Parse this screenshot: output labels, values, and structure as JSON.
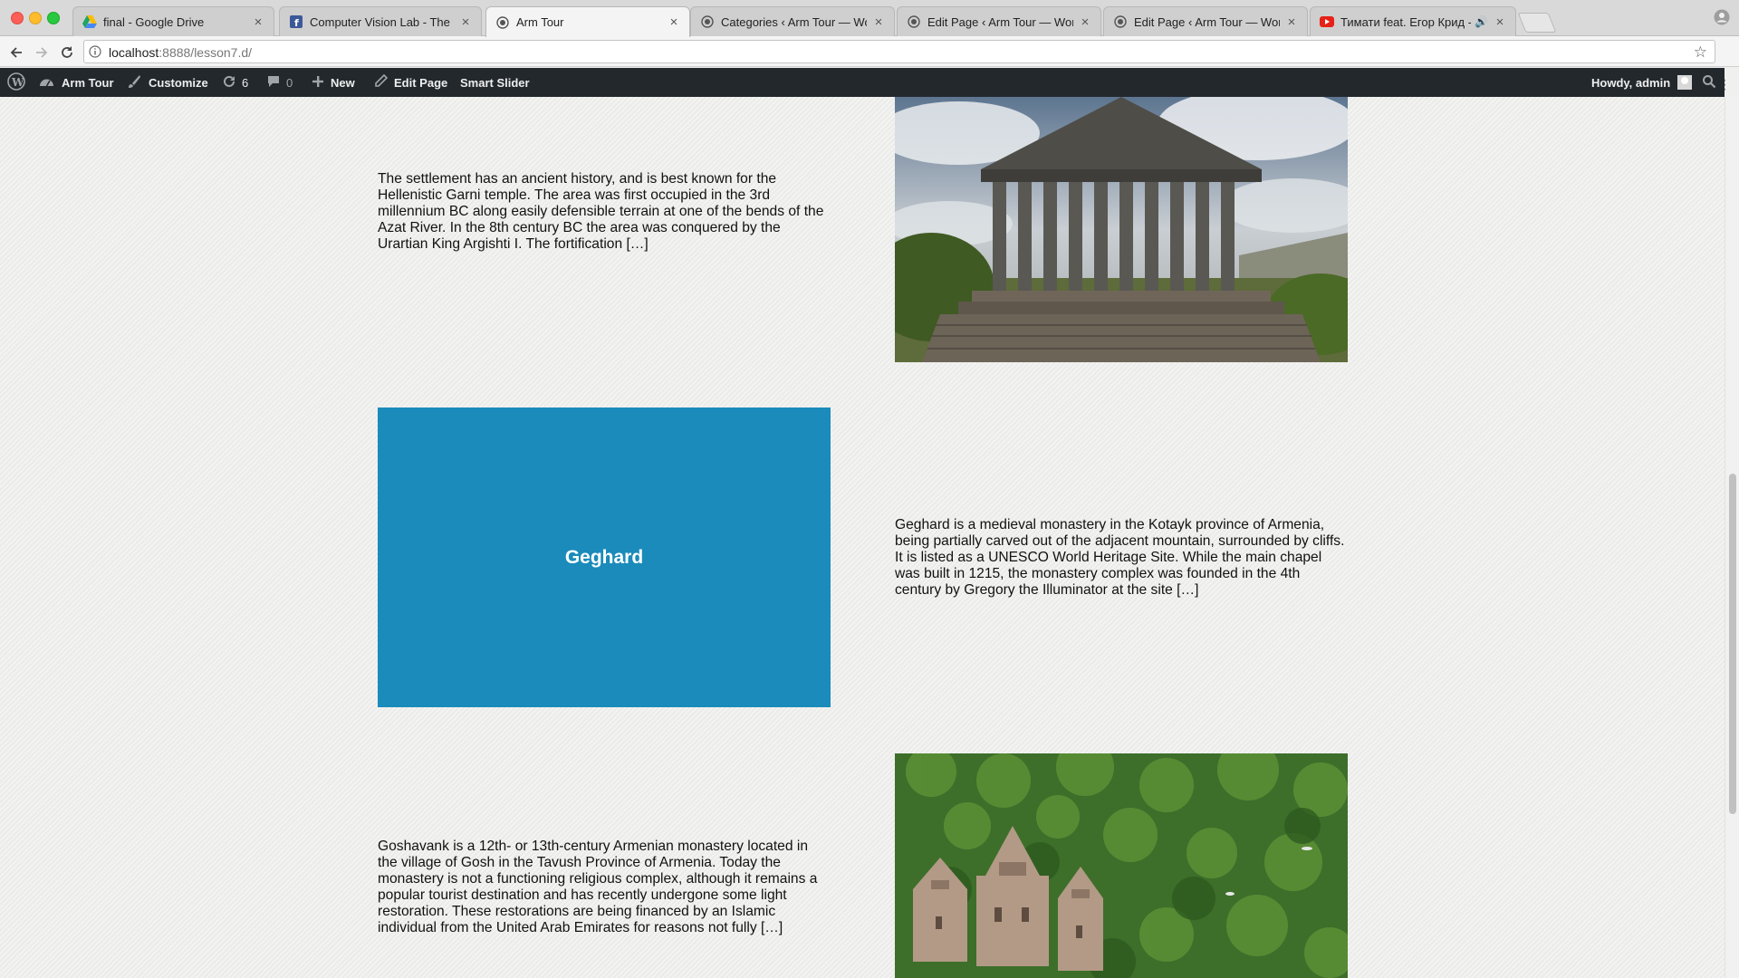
{
  "browser": {
    "tabs": [
      {
        "title": "final - Google Drive",
        "icon": "google-drive-icon",
        "active": false
      },
      {
        "title": "Computer Vision Lab - The Un",
        "icon": "facebook-icon",
        "active": false
      },
      {
        "title": "Arm Tour",
        "icon": "wordpress-icon",
        "active": true
      },
      {
        "title": "Categories ‹ Arm Tour — Word",
        "icon": "wordpress-icon",
        "active": false
      },
      {
        "title": "Edit Page ‹ Arm Tour — WordP",
        "icon": "wordpress-icon",
        "active": false
      },
      {
        "title": "Edit Page ‹ Arm Tour — WordP",
        "icon": "wordpress-icon",
        "active": false
      },
      {
        "title": "Тимати feat. Егор Крид - П",
        "icon": "youtube-icon",
        "active": false,
        "audio": true
      }
    ],
    "url_host": "localhost",
    "url_rest": ":8888/lesson7.d/"
  },
  "adminbar": {
    "site_name": "Arm Tour",
    "customize": "Customize",
    "updates_count": "6",
    "comments_count": "0",
    "new": "New",
    "edit_page": "Edit Page",
    "smart_slider": "Smart Slider",
    "howdy": "Howdy, admin"
  },
  "posts": [
    {
      "text": "The settlement has an ancient history, and is best known for the Hellenistic Garni temple. The area was first occupied in the 3rd millennium BC along easily defensible terrain at one of the bends of the Azat River. In the 8th century BC the area was conquered by the Urartian King Argishti I. The fortification […]",
      "image": "garni-temple-photo"
    },
    {
      "title": "Geghard",
      "text": "Geghard is a medieval monastery in the Kotayk province of Armenia, being partially carved out of the adjacent mountain, surrounded by cliffs. It is listed as a UNESCO World Heritage Site. While the main chapel was built in 1215, the monastery complex was founded in the 4th century by Gregory the Illuminator at the site […]"
    },
    {
      "text": "Goshavank is a 12th- or 13th-century Armenian monastery located in the village of Gosh in the Tavush Province of Armenia. Today the monastery is not a functioning religious complex, although it remains a popular tourist destination and has recently undergone some light restoration. These restorations are being financed by an Islamic individual from the United Arab Emirates for reasons not fully […]",
      "image": "goshavank-monastery-photo"
    }
  ],
  "colors": {
    "adminbar": "#23282d",
    "feature_blue": "#1a8bba",
    "page_bg": "#efefee"
  }
}
